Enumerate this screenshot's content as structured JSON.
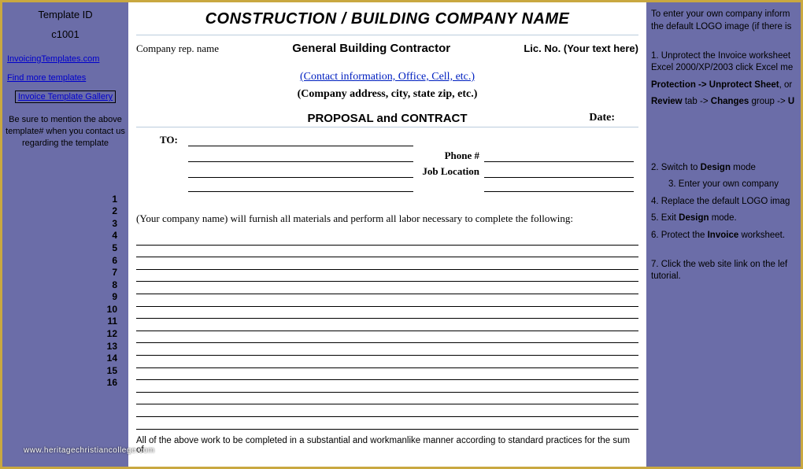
{
  "left": {
    "template_label": "Template ID",
    "template_id": "c1001",
    "link_invoicing": "InvoicingTemplates.com",
    "link_findmore": "Find more templates",
    "link_gallery": "Invoice Template Gallery",
    "note": "Be sure to mention the above template# when you contact us regarding the template",
    "rows": [
      "1",
      "2",
      "3",
      "4",
      "5",
      "6",
      "7",
      "8",
      "9",
      "10",
      "11",
      "12",
      "13",
      "14",
      "15",
      "16"
    ]
  },
  "center": {
    "title": "CONSTRUCTION / BUILDING COMPANY NAME",
    "rep_label": "Company rep. name",
    "contractor": "General Building Contractor",
    "lic_label": "Lic. No. (Your text here)",
    "contact": "(Contact information, Office, Cell, etc.)",
    "address": "(Company address, city, state zip, etc.)",
    "proposal": "PROPOSAL and CONTRACT",
    "date_label": "Date:",
    "to_label": "TO:",
    "phone_label": "Phone #",
    "jobloc_label": "Job Location",
    "furnish": "(Your company name) will furnish all materials and perform all labor necessary to complete the following:",
    "line_count": 16,
    "footer": "All of the above work to be completed in a substantial and workmanlike manner according to standard practices for the sum of"
  },
  "right": {
    "intro": "To enter your own company inform the default LOGO image (if there is",
    "steps": [
      "1. Unprotect the Invoice worksheet Excel 2000/XP/2003 click Excel me",
      "Protection -> Unprotect Sheet, or",
      "Review tab -> Changes group -> U",
      "2. Switch to Design mode",
      "3. Enter your own company",
      "4. Replace the default LOGO imag",
      "5. Exit Design mode.",
      "6. Protect the Invoice worksheet.",
      "7. Click the web site link on the lef tutorial."
    ],
    "bold_protection": "Protection -> Unprotect Sheet",
    "bold_review": "Review",
    "bold_changes": "Changes",
    "bold_design": "Design",
    "bold_invoice": "Invoice"
  },
  "watermark": "www.heritagechristiancollege.com"
}
